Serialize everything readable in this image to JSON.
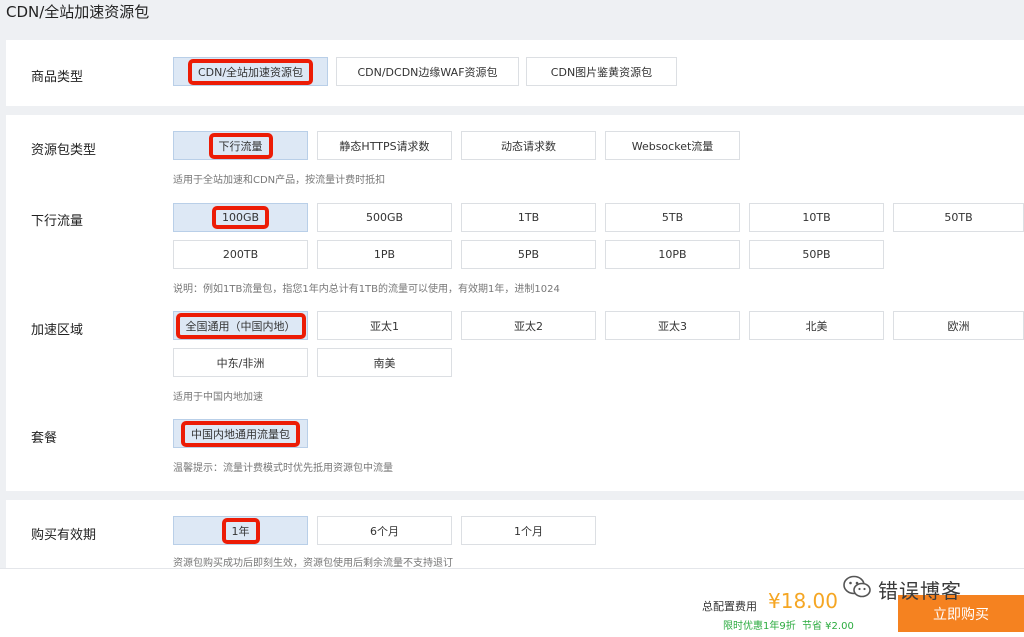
{
  "page": {
    "title": "CDN/全站加速资源包"
  },
  "product_type": {
    "label": "商品类型",
    "options": [
      "CDN/全站加速资源包",
      "CDN/DCDN边缘WAF资源包",
      "CDN图片鉴黄资源包"
    ],
    "selected": "CDN/全站加速资源包"
  },
  "package_type": {
    "label": "资源包类型",
    "options": [
      "下行流量",
      "静态HTTPS请求数",
      "动态请求数",
      "Websocket流量"
    ],
    "selected": "下行流量",
    "hint": "适用于全站加速和CDN产品，按流量计费时抵扣"
  },
  "downstream": {
    "label": "下行流量",
    "options": [
      "100GB",
      "500GB",
      "1TB",
      "5TB",
      "10TB",
      "50TB",
      "200TB",
      "1PB",
      "5PB",
      "10PB",
      "50PB"
    ],
    "selected": "100GB",
    "hint": "说明：例如1TB流量包，指您1年内总计有1TB的流量可以使用，有效期1年，进制1024"
  },
  "region": {
    "label": "加速区域",
    "options": [
      "全国通用（中国内地）",
      "亚太1",
      "亚太2",
      "亚太3",
      "北美",
      "欧洲",
      "中东/非洲",
      "南美"
    ],
    "selected": "全国通用（中国内地）",
    "hint": "适用于中国内地加速"
  },
  "plan": {
    "label": "套餐",
    "options": [
      "中国内地通用流量包"
    ],
    "selected": "中国内地通用流量包",
    "hint": "温馨提示：流量计费模式时优先抵用资源包中流量"
  },
  "validity": {
    "label": "购买有效期",
    "options": [
      "1年",
      "6个月",
      "1个月"
    ],
    "selected": "1年",
    "hint": "资源包购买成功后即刻生效，资源包使用后剩余流量不支持退订"
  },
  "footer": {
    "total_label": "总配置费用",
    "price": "¥18.00",
    "promo": "限时优惠1年9折",
    "save": "节省 ¥2.00",
    "buy_label": "立即购买"
  },
  "watermark": {
    "text": "错误博客",
    "icon": "wechat-icon"
  },
  "colors": {
    "accent": "#f58220",
    "price": "#f5a623",
    "promo": "#2bab3f",
    "selected_bg": "#dde8f5",
    "highlight": "#ec1c06"
  }
}
